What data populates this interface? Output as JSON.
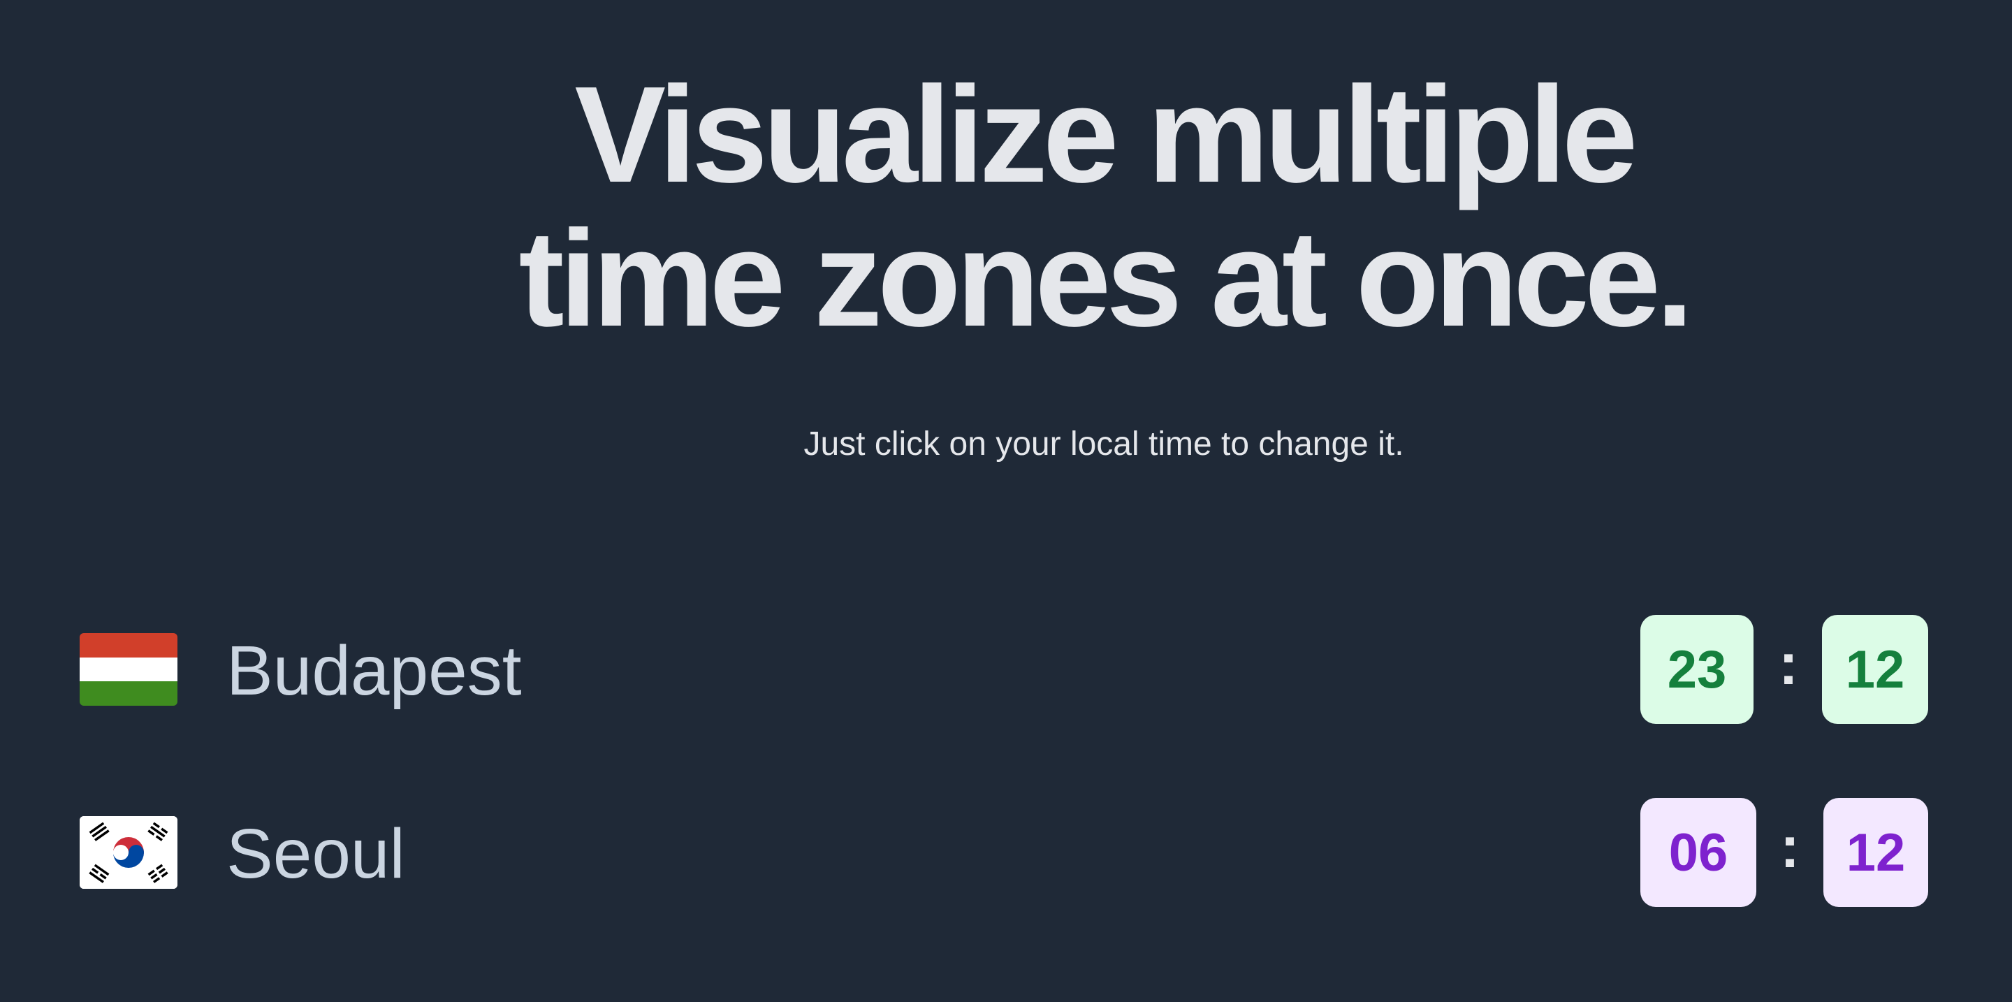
{
  "hero": {
    "title_line1": "Visualize multiple",
    "title_line2": "time zones at once.",
    "subtitle": "Just click on your local time to change it."
  },
  "zones": [
    {
      "city": "Budapest",
      "flag_icon": "hungary-flag-icon",
      "hour": "23",
      "separator": ":",
      "minute": "12",
      "accent_bg": "#dcfce7",
      "accent_text": "#15803d"
    },
    {
      "city": "Seoul",
      "flag_icon": "south-korea-flag-icon",
      "hour": "06",
      "separator": ":",
      "minute": "12",
      "accent_bg": "#f3e8ff",
      "accent_text": "#7e22ce"
    }
  ]
}
